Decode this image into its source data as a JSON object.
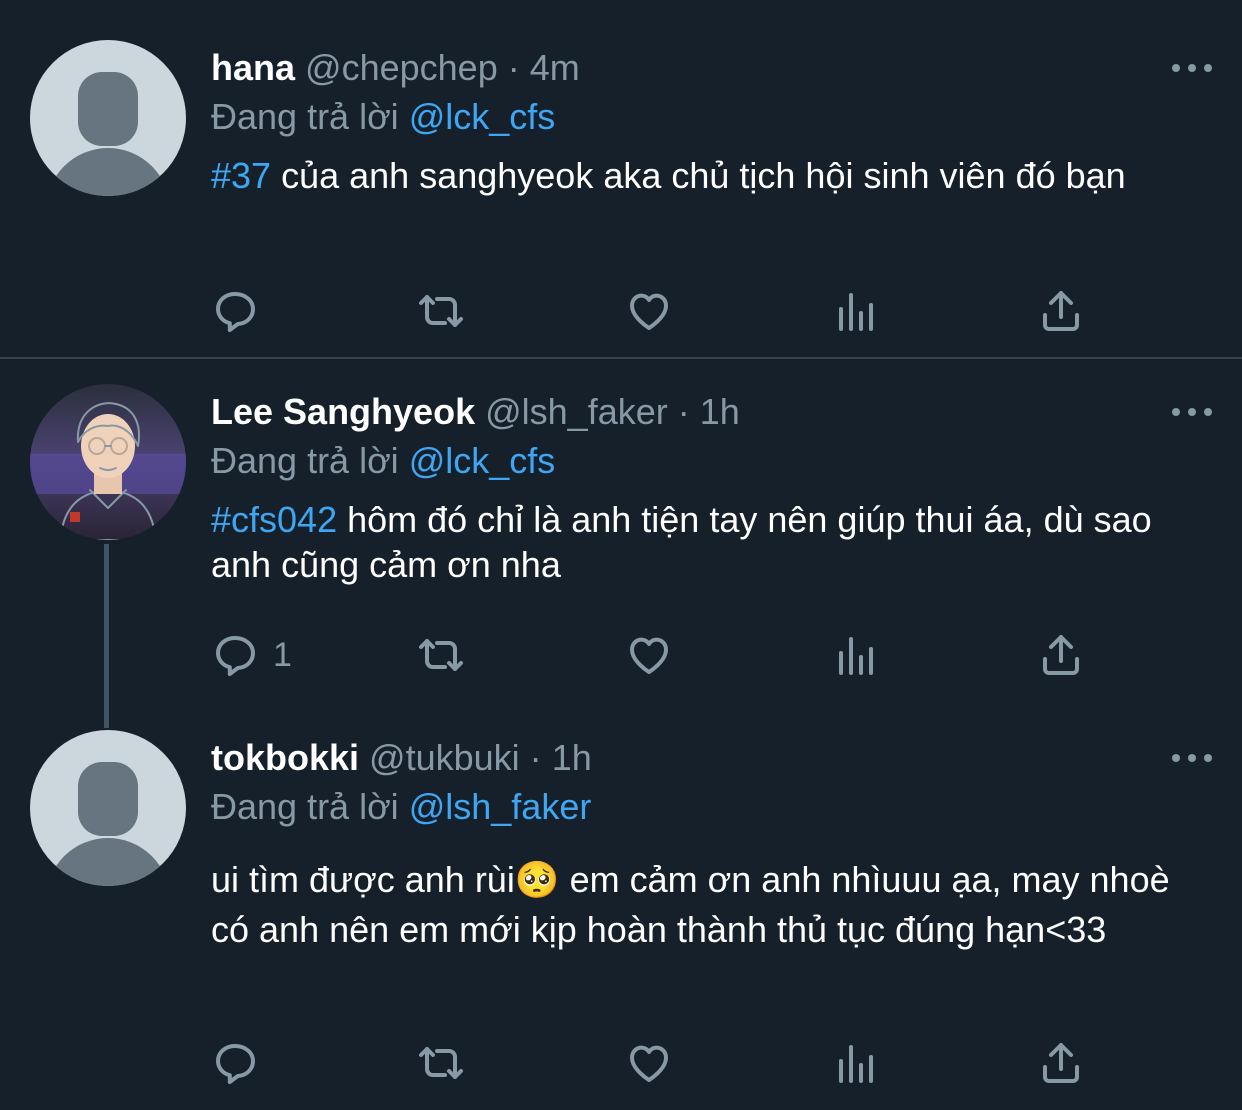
{
  "tweets": [
    {
      "name": "hana",
      "handle": "@chepchep",
      "time": "4m",
      "replying_prefix": "Đang trả lời",
      "replying_to": "@lck_cfs",
      "hashtag": "#37",
      "text": " của anh sanghyeok aka chủ tịch hội sinh viên đó bạn",
      "reply_count": ""
    },
    {
      "name": "Lee Sanghyeok",
      "handle": "@lsh_faker",
      "time": "1h",
      "replying_prefix": "Đang trả lời",
      "replying_to": "@lck_cfs",
      "hashtag": "#cfs042",
      "text": " hôm đó chỉ là anh tiện tay nên giúp thui áa, dù sao anh cũng cảm ơn nha",
      "reply_count": "1"
    },
    {
      "name": "tokbokki",
      "handle": "@tukbuki",
      "time": "1h",
      "replying_prefix": "Đang trả lời",
      "replying_to": "@lsh_faker",
      "hashtag": "",
      "text": "ui tìm được anh rùi🥺 em cảm ơn anh nhìuuu ạa, may nhoè có anh nên em mới kịp hoàn thành thủ tục đúng hạn<33",
      "reply_count": ""
    }
  ],
  "separator": "·",
  "icons": [
    "reply-icon",
    "retweet-icon",
    "like-icon",
    "analytics-icon",
    "share-icon",
    "more-icon"
  ],
  "colors": {
    "background": "#15202b",
    "secondary_text": "#8899a6",
    "link": "#3ea6f2",
    "divider": "#38444d"
  }
}
